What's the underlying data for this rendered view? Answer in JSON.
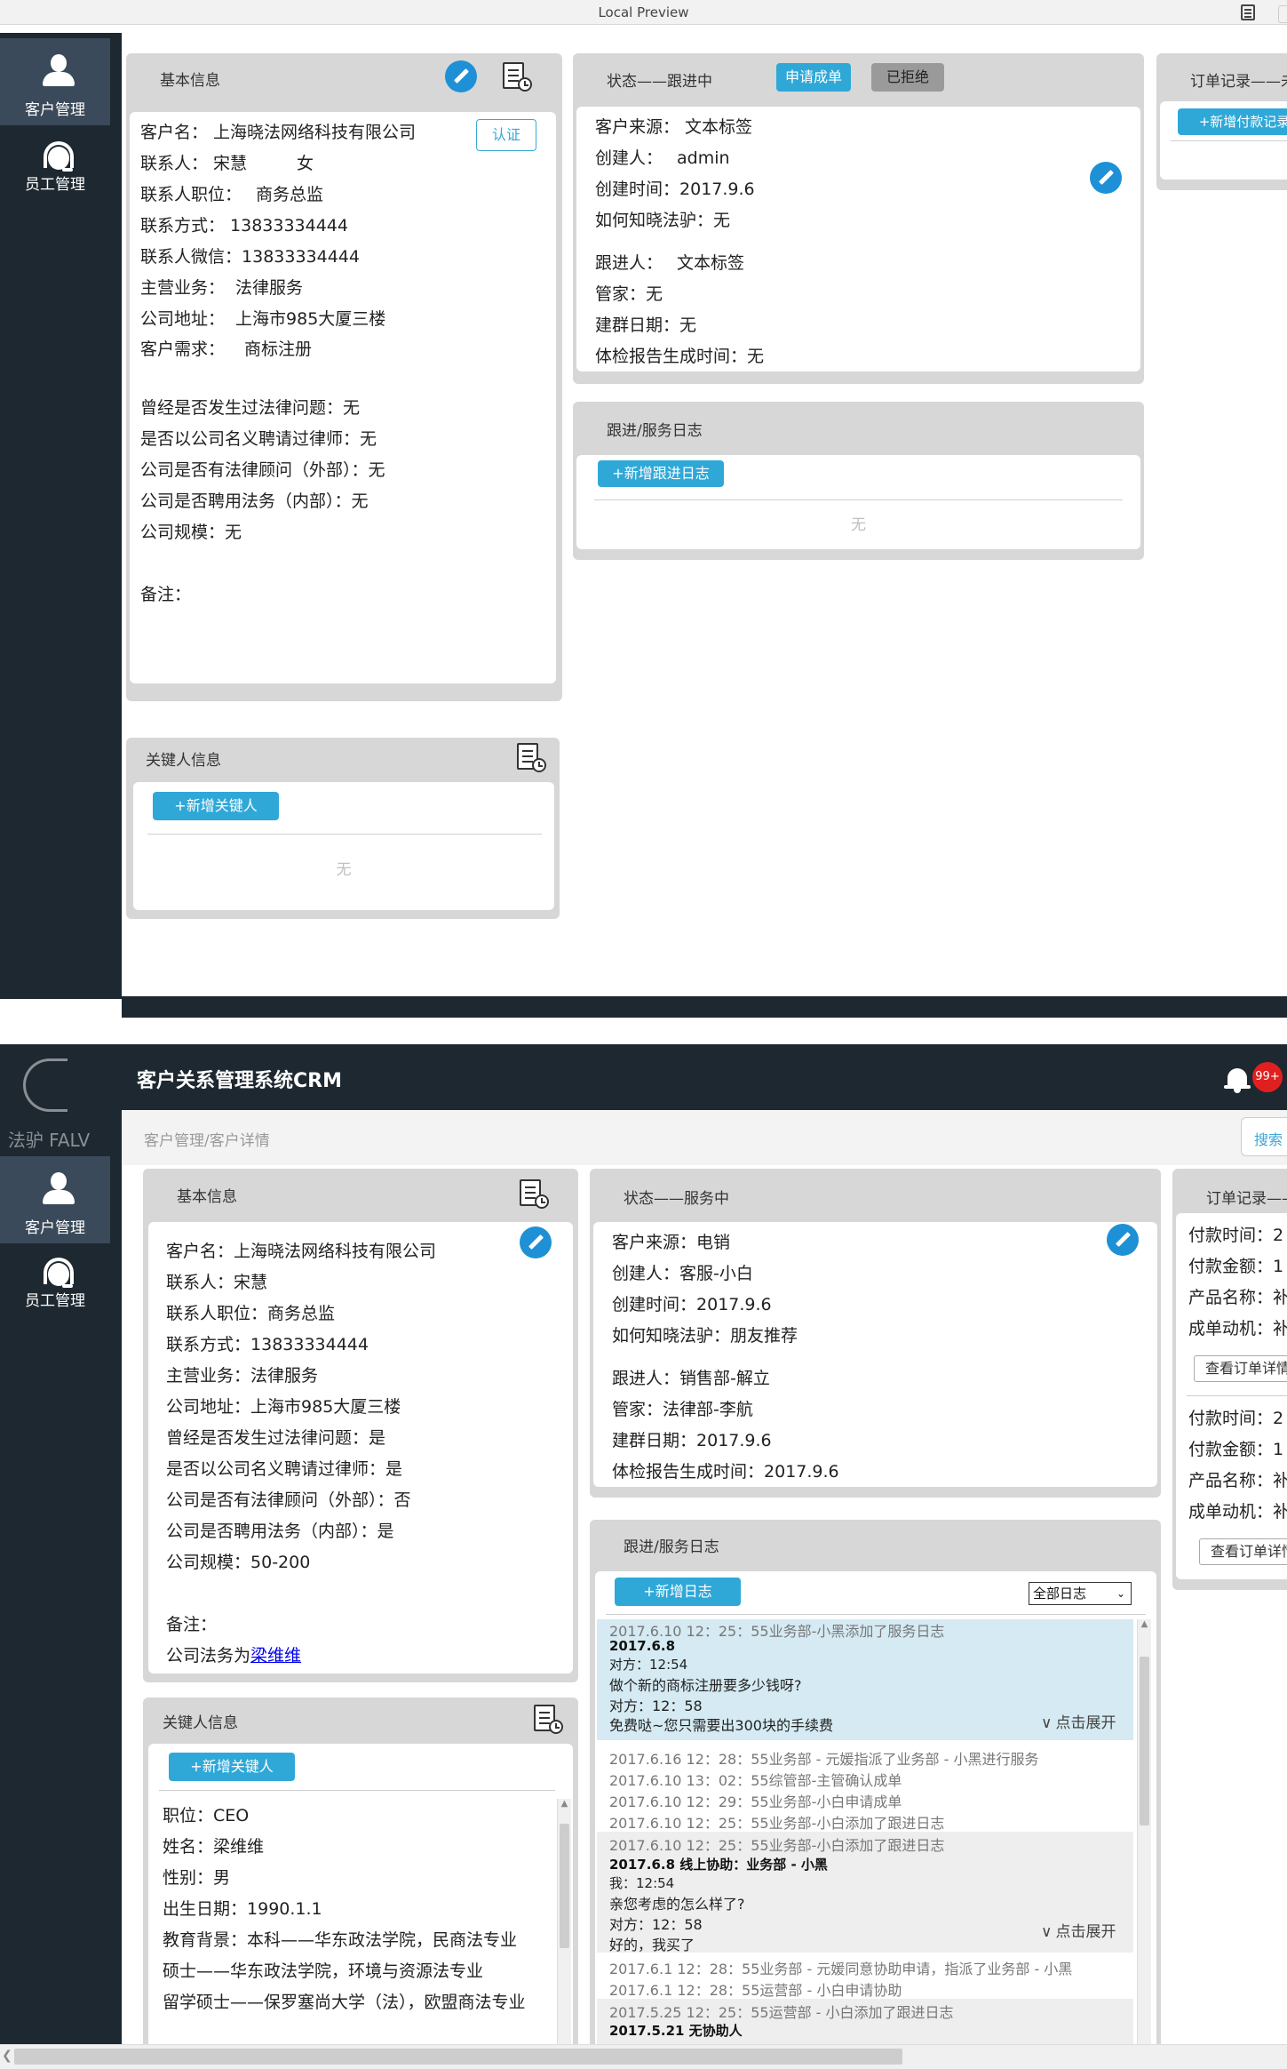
{
  "window": {
    "title": "Local Preview"
  },
  "sidebar": {
    "logo_text": "法驴 FALV",
    "items": [
      {
        "label": "客户管理",
        "icon": "person-icon"
      },
      {
        "label": "员工管理",
        "icon": "headset-icon"
      }
    ]
  },
  "app_header": {
    "title": "客户关系管理系统CRM",
    "notification_badge": "99+",
    "breadcrumb": "客户管理/客户详情",
    "search_placeholder": "搜索"
  },
  "preview1": {
    "basic": {
      "title": "基本信息",
      "verify_label": "认证",
      "rows": [
        {
          "label": "客户名：",
          "value": "上海晓法网络科技有限公司"
        },
        {
          "label": "联系人：",
          "value": "宋慧",
          "extra": "女"
        },
        {
          "label": "联系人职位：",
          "value": "商务总监"
        },
        {
          "label": "联系方式：",
          "value": "13833334444"
        },
        {
          "label": "联系人微信：",
          "value": "13833334444"
        },
        {
          "label": "主营业务：",
          "value": "法律服务"
        },
        {
          "label": "公司地址：",
          "value": "上海市985大厦三楼"
        },
        {
          "label": "客户需求：",
          "value": "商标注册"
        },
        {
          "label": "曾经是否发生过法律问题：",
          "value": "无"
        },
        {
          "label": "是否以公司名义聘请过律师：",
          "value": "无"
        },
        {
          "label": "公司是否有法律顾问（外部）：",
          "value": "无"
        },
        {
          "label": "公司是否聘用法务（内部）：",
          "value": "无"
        },
        {
          "label": "公司规模：",
          "value": "无"
        },
        {
          "label": "备注：",
          "value": ""
        }
      ]
    },
    "status": {
      "title": "状态——跟进中",
      "apply_label": "申请成单",
      "reject_label": "已拒绝",
      "rows": [
        {
          "label": "客户来源：",
          "value": "文本标签"
        },
        {
          "label": "创建人：",
          "value": "admin"
        },
        {
          "label": "创建时间：",
          "value": "2017.9.6"
        },
        {
          "label": "如何知晓法驴：",
          "value": "无"
        },
        {
          "label": "跟进人：",
          "value": "文本标签"
        },
        {
          "label": "管家：",
          "value": "无"
        },
        {
          "label": "建群日期：",
          "value": "无"
        },
        {
          "label": "体检报告生成时间：",
          "value": "无"
        }
      ]
    },
    "log": {
      "title": "跟进/服务日志",
      "add_label": "+新增跟进日志",
      "empty": "无"
    },
    "key_person": {
      "title": "关键人信息",
      "add_label": "+新增关键人",
      "empty": "无"
    },
    "orders": {
      "title": "订单记录——未",
      "add_label": "+新增付款记录"
    }
  },
  "preview2": {
    "basic": {
      "title": "基本信息",
      "rows": [
        {
          "label": "客户名：",
          "value": "上海晓法网络科技有限公司"
        },
        {
          "label": "联系人：",
          "value": "宋慧"
        },
        {
          "label": "联系人职位：",
          "value": "商务总监"
        },
        {
          "label": "联系方式：",
          "value": "13833334444"
        },
        {
          "label": "主营业务：",
          "value": "法律服务"
        },
        {
          "label": "公司地址：",
          "value": "上海市985大厦三楼"
        },
        {
          "label": "曾经是否发生过法律问题：",
          "value": "是"
        },
        {
          "label": "是否以公司名义聘请过律师：",
          "value": "是"
        },
        {
          "label": "公司是否有法律顾问（外部）：",
          "value": "否"
        },
        {
          "label": "公司是否聘用法务（内部）：",
          "value": "是"
        },
        {
          "label": "公司规模：",
          "value": "50-200"
        }
      ],
      "remark_label": "备注：",
      "remark_prefix": "公司法务为",
      "remark_link": "梁维维"
    },
    "status": {
      "title": "状态——服务中",
      "rows": [
        {
          "label": "客户来源：",
          "value": "电销"
        },
        {
          "label": "创建人：",
          "value": "客服-小白"
        },
        {
          "label": "创建时间：",
          "value": "2017.9.6"
        },
        {
          "label": "如何知晓法驴：",
          "value": "朋友推荐"
        },
        {
          "label": "跟进人：",
          "value": "销售部-解立"
        },
        {
          "label": "管家：",
          "value": "法律部-李航"
        },
        {
          "label": "建群日期：",
          "value": "2017.9.6"
        },
        {
          "label": "体检报告生成时间：",
          "value": "2017.9.6"
        }
      ]
    },
    "log": {
      "title": "跟进/服务日志",
      "add_label": "+新增日志",
      "filter_value": "全部日志",
      "expand_label": "点击展开",
      "entries": [
        "2017.6.10 12：25：55业务部-小黑添加了服务日志",
        "2017.6.8",
        "对方：12:54",
        "做个新的商标注册要多少钱呀?",
        "对方：12：58",
        "免费哒~您只需要出300块的手续费",
        "2017.6.16 12：28：55业务部 - 元媛指派了业务部 - 小黑进行服务",
        "2017.6.10 13：02：55综管部-主管确认成单",
        "2017.6.10 12：29：55业务部-小白申请成单",
        "2017.6.10 12：25：55业务部-小白添加了跟进日志",
        "2017.6.10 12：25：55业务部-小白添加了跟进日志",
        "2017.6.8   线上协助：业务部 - 小黑",
        "我：12:54",
        "亲您考虑的怎么样了?",
        "对方：12：58",
        "好的，我买了",
        "2017.6.1 12：28：55业务部 - 元媛同意协助申请，指派了业务部 - 小黑",
        "2017.6.1 12：28：55运营部 - 小白申请协助",
        "2017.5.25 12：25：55运营部 - 小白添加了跟进日志",
        "2017.5.21   无协助人"
      ]
    },
    "key_person": {
      "title": "关键人信息",
      "add_label": "+新增关键人",
      "rows": [
        {
          "label": "职位：",
          "value": "CEO"
        },
        {
          "label": "姓名：",
          "value": "梁维维"
        },
        {
          "label": "性别：",
          "value": "男"
        },
        {
          "label": "出生日期：",
          "value": "1990.1.1"
        },
        {
          "label": "教育背景：",
          "value": "本科——华东政法学院，民商法专业"
        },
        {
          "label": "",
          "value": "硕士——华东政法学院，环境与资源法专业"
        },
        {
          "label": "",
          "value": "留学硕士——保罗塞尚大学（法），欧盟商法专业"
        }
      ]
    },
    "orders": {
      "title": "订单记录——",
      "groups": [
        {
          "rows": [
            "付款时间：2",
            "付款金额：1",
            "产品名称：补",
            "成单动机：补"
          ],
          "button": "查看订单详情"
        },
        {
          "rows": [
            "付款时间：2",
            "付款金额：1",
            "产品名称：补",
            "成单动机：补"
          ],
          "button": "查看订单详情"
        }
      ]
    }
  }
}
